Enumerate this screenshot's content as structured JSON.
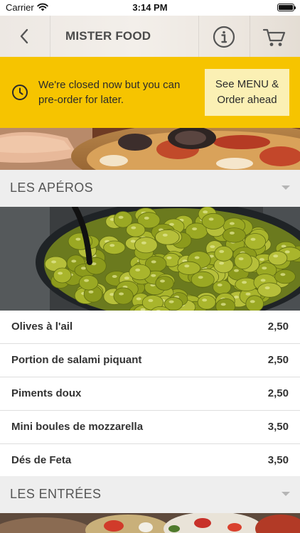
{
  "status_bar": {
    "carrier": "Carrier",
    "time": "3:14 PM",
    "icons": [
      "wifi-icon",
      "battery-icon"
    ]
  },
  "nav": {
    "title": "MISTER FOOD",
    "icons": [
      "chevron-left-icon",
      "info-icon",
      "cart-icon"
    ]
  },
  "banner": {
    "message": "We're closed now but you can pre-order for later.",
    "button_label": "See MENU & Order ahead",
    "icon": "clock-icon",
    "color": "#f6c400"
  },
  "sections": [
    {
      "title": "LES APÉROS",
      "items": [
        {
          "name": "Olives à l'ail",
          "price": "2,50"
        },
        {
          "name": "Portion de salami piquant",
          "price": "2,50"
        },
        {
          "name": "Piments doux",
          "price": "2,50"
        },
        {
          "name": "Mini boules de mozzarella",
          "price": "3,50"
        },
        {
          "name": "Dés de Feta",
          "price": "3,50"
        }
      ]
    },
    {
      "title": "LES ENTRÉES",
      "items": []
    }
  ]
}
